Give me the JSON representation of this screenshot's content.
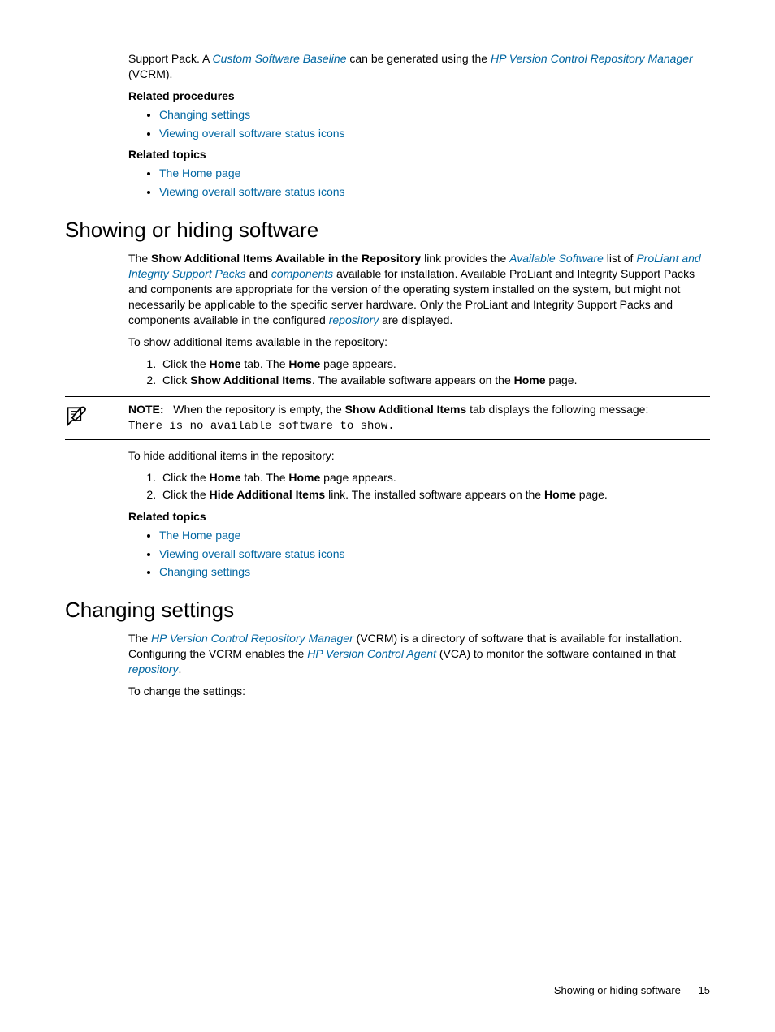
{
  "intro": {
    "frag1": "Support Pack. A ",
    "link1": "Custom Software Baseline",
    "frag2": " can be generated using the ",
    "link2": "HP Version Control Repository Manager",
    "frag3": " (VCRM)."
  },
  "relatedProceduresHeading": "Related procedures",
  "relatedProcedures1": [
    "Changing settings",
    "Viewing overall software status icons"
  ],
  "relatedTopicsHeading": "Related topics",
  "relatedTopics1": [
    "The Home page",
    "Viewing overall software status icons"
  ],
  "h1a": "Showing or hiding software",
  "sec2": {
    "p1a": "The ",
    "p1bold": "Show Additional Items Available in the Repository",
    "p1b": " link provides the ",
    "p1link1": "Available Software",
    "p1c": " list of ",
    "p1link2": "ProLiant and Integrity Support Packs",
    "p1d": " and ",
    "p1link3": "components",
    "p1e": " available for installation. Available ProLiant and Integrity Support Packs and components are appropriate for the version of the operating system installed on the system, but might not necessarily be applicable to the specific server hardware. Only the ProLiant and Integrity Support Packs and components available in the configured ",
    "p1link4": "repository",
    "p1f": " are displayed.",
    "p2": "To show additional items available in the repository:",
    "step1a": "Click the ",
    "step1b": "Home",
    "step1c": " tab. The ",
    "step1d": "Home",
    "step1e": " page appears.",
    "step2a": "Click ",
    "step2b": "Show Additional Items",
    "step2c": ". The available software appears on the ",
    "step2d": "Home",
    "step2e": " page."
  },
  "note": {
    "label": "NOTE:",
    "text1": "When the repository is empty, the ",
    "bold": "Show Additional Items",
    "text2": " tab displays the following message: ",
    "code": "There is no available software to show."
  },
  "hide": {
    "intro": "To hide additional items in the repository:",
    "s1a": "Click the ",
    "s1b": "Home",
    "s1c": " tab. The ",
    "s1d": "Home",
    "s1e": " page appears.",
    "s2a": "Click the ",
    "s2b": "Hide Additional Items",
    "s2c": " link. The installed software appears on the ",
    "s2d": "Home",
    "s2e": " page."
  },
  "relatedTopics2": [
    "The Home page",
    "Viewing overall software status icons",
    "Changing settings"
  ],
  "h1b": "Changing settings",
  "sec3": {
    "p1a": "The ",
    "link1": "HP Version Control Repository Manager",
    "p1b": " (VCRM) is a directory of software that is available for installation. Configuring the VCRM enables the ",
    "link2": "HP Version Control Agent",
    "p1c": " (VCA) to monitor the software contained in that ",
    "link3": "repository",
    "p1d": ".",
    "p2": "To change the settings:"
  },
  "footer": {
    "text": "Showing or hiding software",
    "page": "15"
  }
}
